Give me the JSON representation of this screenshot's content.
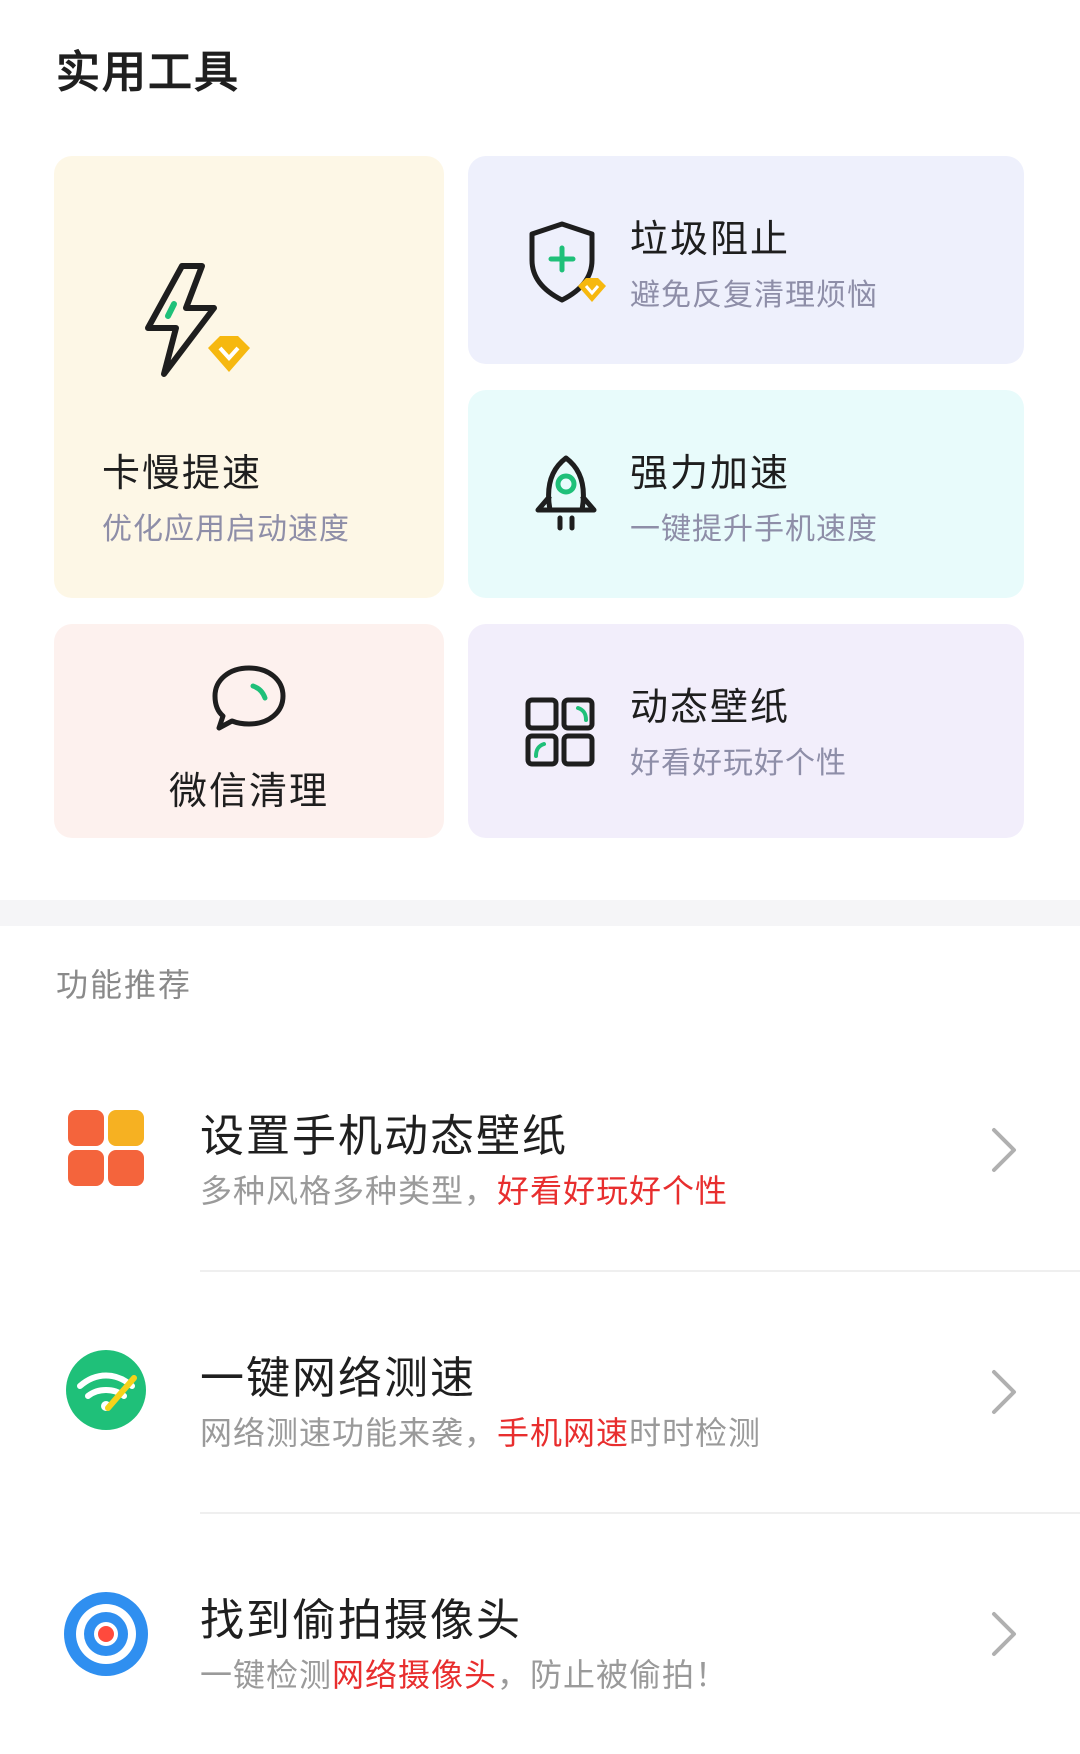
{
  "tools": {
    "heading": "实用工具",
    "cards": [
      {
        "title": "卡慢提速",
        "subtitle": "优化应用启动速度",
        "icon": "lightning-vip-icon",
        "bg": "#fdf7e6"
      },
      {
        "title": "垃圾阻止",
        "subtitle": "避免反复清理烦恼",
        "icon": "shield-plus-vip-icon",
        "bg": "#eef0fc"
      },
      {
        "title": "强力加速",
        "subtitle": "一键提升手机速度",
        "icon": "rocket-icon",
        "bg": "#e8fbfb"
      },
      {
        "title": "微信清理",
        "icon": "chat-bubble-icon",
        "bg": "#fdf1ee"
      },
      {
        "title": "动态壁纸",
        "subtitle": "好看好玩好个性",
        "icon": "app-grid-icon",
        "bg": "#f2eefb"
      }
    ]
  },
  "recommend": {
    "heading": "功能推荐",
    "items": [
      {
        "title": "设置手机动态壁纸",
        "subtitle_parts": [
          "多种风格多种类型，",
          "好看好玩好个性",
          ""
        ],
        "icon": "colorful-squares-icon"
      },
      {
        "title": "一键网络测速",
        "subtitle_parts": [
          "网络测速功能来袭，",
          "手机网速",
          "时时检测"
        ],
        "icon": "wifi-speed-icon"
      },
      {
        "title": "找到偷拍摄像头",
        "subtitle_parts": [
          "一键检测",
          "网络摄像头",
          "，防止被偷拍！"
        ],
        "icon": "camera-detect-icon"
      }
    ]
  },
  "colors": {
    "accent_green": "#1fc079",
    "highlight_red": "#e82e2e",
    "vip_gold": "#f6b80f"
  }
}
